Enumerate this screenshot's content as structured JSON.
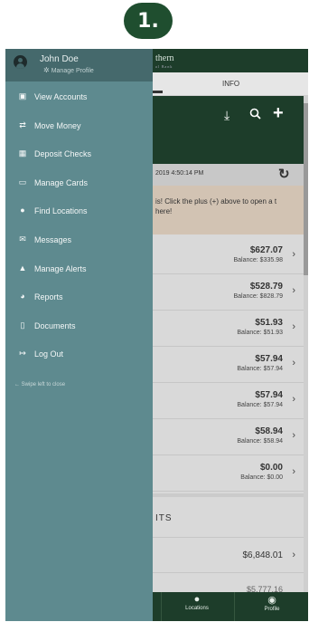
{
  "step_badge": "1.",
  "drawer": {
    "user_name": "John Doe",
    "manage_profile": "Manage Profile",
    "items": [
      {
        "label": "View Accounts",
        "icon": "accounts-icon"
      },
      {
        "label": "Move Money",
        "icon": "transfer-icon",
        "highlighted": true
      },
      {
        "label": "Deposit Checks",
        "icon": "bank-icon"
      },
      {
        "label": "Manage Cards",
        "icon": "card-icon"
      },
      {
        "label": "Find Locations",
        "icon": "location-pin-icon"
      },
      {
        "label": "Messages",
        "icon": "mail-icon"
      },
      {
        "label": "Manage Alerts",
        "icon": "bell-icon"
      },
      {
        "label": "Reports",
        "icon": "pie-chart-icon"
      },
      {
        "label": "Documents",
        "icon": "document-icon"
      },
      {
        "label": "Log Out",
        "icon": "logout-icon"
      }
    ],
    "swipe_hint": "Swipe left to close"
  },
  "app": {
    "logo": "thern",
    "logo_sub": "al Bank",
    "tab_info": "INFO",
    "timestamp": "2019 4:50:14 PM",
    "notice": "is! Click the plus (+) above to open a t here!",
    "accounts": [
      {
        "amount": "$627.07",
        "balance": "Balance: $335.98"
      },
      {
        "amount": "$528.79",
        "balance": "Balance: $828.79"
      },
      {
        "amount": "$51.93",
        "balance": "Balance: $51.93"
      },
      {
        "amount": "$57.94",
        "balance": "Balance: $57.94"
      },
      {
        "amount": "$57.94",
        "balance": "Balance: $57.94"
      },
      {
        "amount": "$58.94",
        "balance": "Balance: $58.94"
      },
      {
        "amount": "$0.00",
        "balance": "Balance: $0.00"
      }
    ],
    "section_title": "ITS",
    "loan_amount": "$6,848.01",
    "cut_amount": "$5,777.16",
    "bottom_nav": {
      "locations": "Locations",
      "profile": "Profile"
    }
  },
  "colors": {
    "brand_green": "#1d3d2a",
    "drawer_bg": "#5e8a8f",
    "highlight": "#e25d43"
  }
}
